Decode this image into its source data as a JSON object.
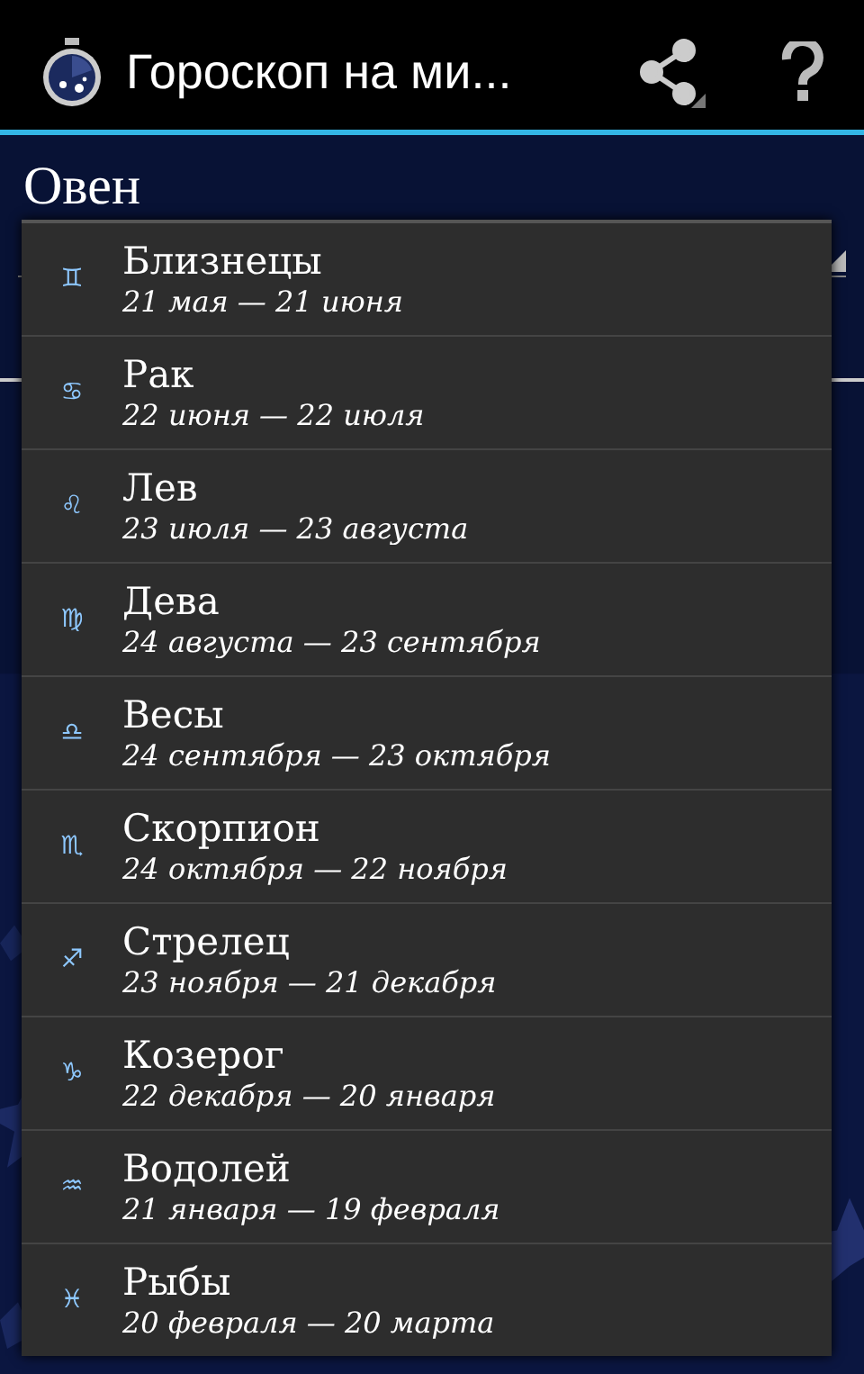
{
  "action_bar": {
    "title": "Гороскоп на ми..."
  },
  "spinner": {
    "value": "Овен"
  },
  "dropdown": [
    {
      "symbol": "♊",
      "name": "Близнецы",
      "dates": "21 мая — 21 июня"
    },
    {
      "symbol": "♋",
      "name": "Рак",
      "dates": "22 июня — 22 июля"
    },
    {
      "symbol": "♌",
      "name": "Лев",
      "dates": "23 июля — 23 августа"
    },
    {
      "symbol": "♍",
      "name": "Дева",
      "dates": "24 августа — 23 сентября"
    },
    {
      "symbol": "♎",
      "name": "Весы",
      "dates": "24 сентября — 23 октября"
    },
    {
      "symbol": "♏",
      "name": "Скорпион",
      "dates": "24 октября — 22 ноября"
    },
    {
      "symbol": "♐",
      "name": "Стрелец",
      "dates": "23 ноября — 21 декабря"
    },
    {
      "symbol": "♑",
      "name": "Козерог",
      "dates": "22 декабря — 20 января"
    },
    {
      "symbol": "♒",
      "name": "Водолей",
      "dates": "21 января — 19 февраля"
    },
    {
      "symbol": "♓",
      "name": "Рыбы",
      "dates": "20 февраля — 20 марта"
    }
  ]
}
